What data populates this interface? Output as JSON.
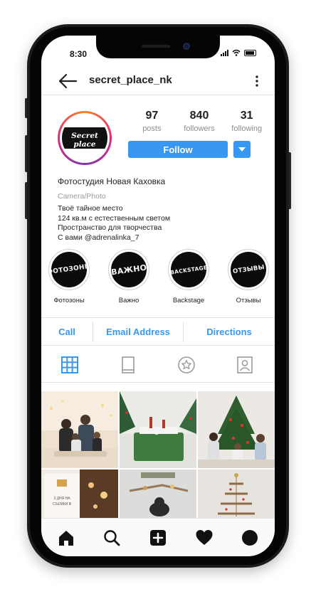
{
  "status_bar": {
    "time": "8:30"
  },
  "header": {
    "username": "secret_place_nk"
  },
  "profile": {
    "avatar_text": "Secret place",
    "stats": [
      {
        "value": "97",
        "label": "posts"
      },
      {
        "value": "840",
        "label": "followers"
      },
      {
        "value": "31",
        "label": "following"
      }
    ],
    "follow_label": "Follow"
  },
  "bio": {
    "name": "Фотостудия Новая Каховка",
    "category": "Camera/Photo",
    "lines": [
      "Твоё тайное место",
      "124 кв.м с естественным светом",
      "Пространство для творчества",
      "С вами @adrenalinka_7"
    ]
  },
  "highlights": [
    {
      "cover_text": "ФОТОЗОНЫ",
      "label": "Фотозоны"
    },
    {
      "cover_text": "ВАЖНО",
      "label": "Важно"
    },
    {
      "cover_text": "BACKSTAGE",
      "label": "Backstage"
    },
    {
      "cover_text": "ОТЗЫВЫ",
      "label": "Отзывы"
    }
  ],
  "contact": {
    "call": "Call",
    "email": "Email Address",
    "directions": "Directions"
  },
  "tabs": [
    "grid-icon",
    "igtv-icon",
    "star-icon",
    "tagged-icon"
  ],
  "grid_card_text": "3 ДНЯ НА СЪЕМКИ В",
  "nav": [
    "home-icon",
    "search-icon",
    "add-icon",
    "heart-icon",
    "profile-icon"
  ],
  "colors": {
    "accent": "#3897f0",
    "dark": "#111111"
  }
}
